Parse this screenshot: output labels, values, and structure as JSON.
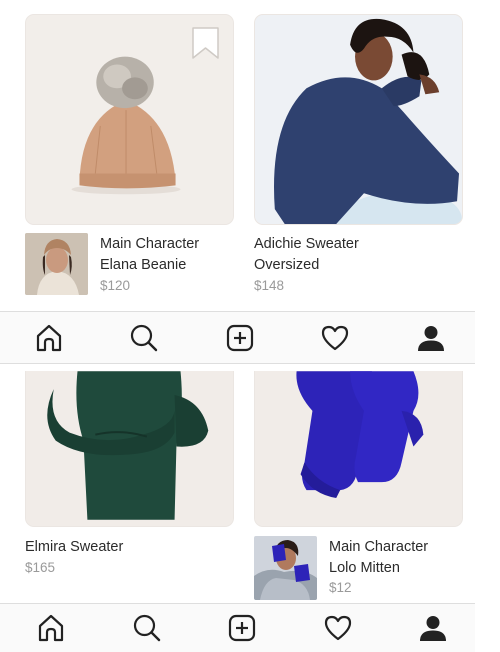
{
  "products": [
    {
      "title": [
        "Main Character",
        "Elana Beanie"
      ],
      "price": "$120",
      "image": "tan-pom-beanie",
      "thumb": "model-in-beanie",
      "saved_icon": "bookmark-icon"
    },
    {
      "title": [
        "Adichie Sweater",
        "Oversized"
      ],
      "price": "$148",
      "image": "model-navy-sweater"
    },
    {
      "title": [
        "Elmira Sweater"
      ],
      "price": "$165",
      "image": "green-sweater-dress"
    },
    {
      "title": [
        "Main Character",
        "Lolo Mitten"
      ],
      "price": "$12",
      "image": "cobalt-mittens",
      "thumb": "model-in-mittens"
    }
  ],
  "tabbar": {
    "items": [
      "home-icon",
      "search-icon",
      "new-post-icon",
      "heart-icon",
      "profile-icon"
    ]
  },
  "colors": {
    "beanie": "#d2a07f",
    "navy": "#2f416f",
    "green": "#1f4a3c",
    "mitten": "#2d23b8",
    "card_bg": "#f1ece8",
    "price": "#9a9a9a"
  }
}
